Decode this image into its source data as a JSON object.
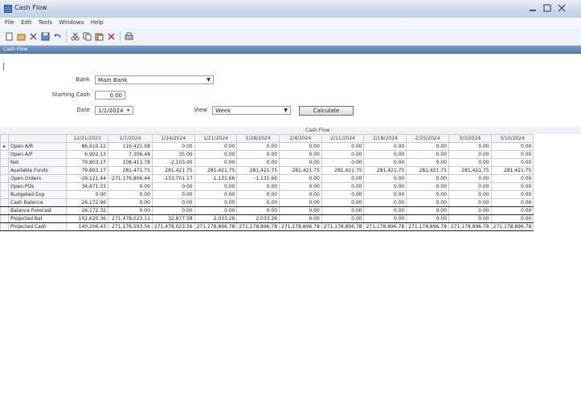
{
  "window": {
    "title": "Cash Flow"
  },
  "menu": [
    "File",
    "Edit",
    "Tools",
    "Windows",
    "Help"
  ],
  "toolbar_icons": [
    "new-icon",
    "open-icon",
    "close-icon",
    "save-icon",
    "undo-icon",
    "cut-icon",
    "copy-icon",
    "paste-icon",
    "delete-icon",
    "print-icon"
  ],
  "panel": {
    "title": "Cash Flow"
  },
  "form": {
    "bank_label": "Bank",
    "bank_value": "Main Bank",
    "starting_cash_label": "Starting Cash",
    "starting_cash_value": "0.00",
    "date_label": "Date",
    "date_value": "1/1/2024",
    "view_label": "View",
    "view_value": "Week",
    "calculate_label": "Calculate"
  },
  "grid": {
    "header_title": "Cash Flow",
    "columns": [
      "12/31/2023",
      "1/7/2024",
      "1/14/2024",
      "1/21/2024",
      "1/28/2024",
      "2/4/2024",
      "2/11/2024",
      "2/18/2024",
      "2/25/2024",
      "3/3/2024",
      "3/10/2024"
    ],
    "rows": [
      {
        "label": "Open A/R",
        "indicator": "▸",
        "values": [
          "86,610.12",
          "116,421.08",
          "0.00",
          "0.00",
          "0.00",
          "0.00",
          "0.00",
          "0.00",
          "0.00",
          "0.00",
          "0.00"
        ]
      },
      {
        "label": "Open A/P",
        "values": [
          "6,902.13",
          "7,306.48",
          "35.00",
          "0.00",
          "0.00",
          "0.00",
          "0.00",
          "0.00",
          "0.00",
          "0.00",
          "0.00"
        ]
      },
      {
        "label": "Net",
        "values": [
          "79,803.17",
          "108,413.78",
          "-2,103.00",
          "0.00",
          "0.00",
          "0.00",
          "0.00",
          "0.00",
          "0.00",
          "0.00",
          "0.00"
        ]
      },
      {
        "label": "Available Funds",
        "values": [
          "79,803.17",
          "281,471.75",
          "281,421.75",
          "281,421.75",
          "281,421.75",
          "281,421.75",
          "281,421.75",
          "281,421.75",
          "281,421.75",
          "281,421.75",
          "281,421.75"
        ]
      },
      {
        "label": "Open Orders",
        "values": [
          "-26,121.44",
          "-271,176,806.44",
          "-133,701.17",
          "-1,131.66",
          "-1,131.66",
          "0.00",
          "0.00",
          "0.00",
          "0.00",
          "0.00",
          "0.00"
        ]
      },
      {
        "label": "Open POs",
        "values": [
          "34,871.33",
          "0.00",
          "0.00",
          "0.00",
          "0.00",
          "0.00",
          "0.00",
          "0.00",
          "0.00",
          "0.00",
          "0.00"
        ]
      },
      {
        "label": "Budgeted Exp",
        "values": [
          "0.00",
          "0.00",
          "0.00",
          "0.00",
          "0.00",
          "0.00",
          "0.00",
          "0.00",
          "0.00",
          "0.00",
          "0.00"
        ]
      },
      {
        "label": "Cash Balance",
        "hl": true,
        "values": [
          "26,172.96",
          "0.00",
          "0.00",
          "0.00",
          "0.00",
          "0.00",
          "0.00",
          "0.00",
          "0.00",
          "0.00",
          "0.00"
        ]
      },
      {
        "label": "Balance Forecast",
        "hl": true,
        "values": [
          "26,172.32",
          "0.00",
          "0.00",
          "0.00",
          "0.00",
          "0.00",
          "0.00",
          "0.00",
          "0.00",
          "0.00",
          "0.00"
        ]
      },
      {
        "label": "Projected Bal",
        "hl": true,
        "values": [
          "102,620.36",
          "271,478,023.11",
          "32,877.58",
          "2,033.26",
          "2,033.26",
          "0.00",
          "0.00",
          "0.00",
          "0.00",
          "0.00",
          "0.00"
        ]
      },
      {
        "label": "Projected Cash",
        "hl": true,
        "values": [
          "140,206.43",
          "271,176,593.56",
          "271,478,023.56",
          "271,178,896.78",
          "271,178,896.78",
          "271,178,896.78",
          "271,178,896.78",
          "271,178,896.78",
          "271,178,896.78",
          "271,178,896.78",
          "271,178,896.78"
        ]
      }
    ]
  }
}
